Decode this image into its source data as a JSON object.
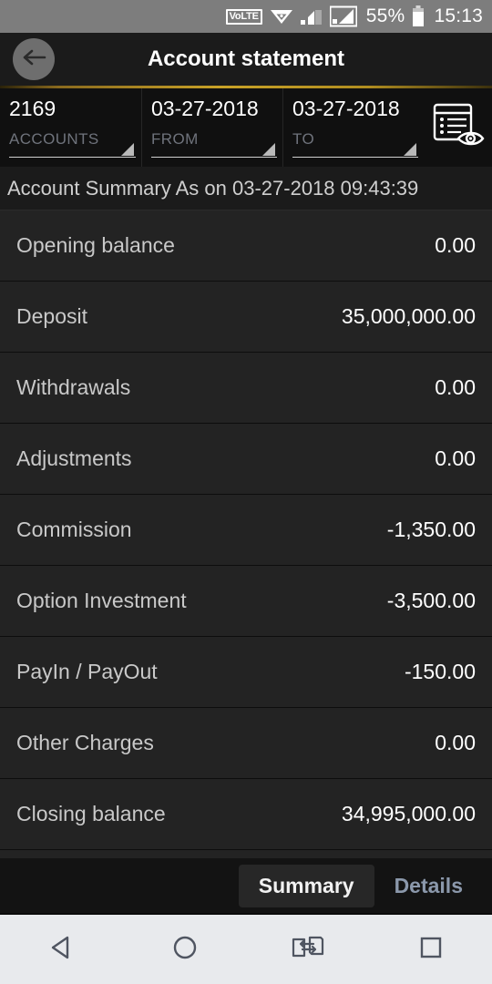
{
  "statusbar": {
    "volte": "VoLTE",
    "wifi_icon": "wifi-icon",
    "signal1_icon": "signal-bars-icon",
    "signal2_icon": "signal-bars-boxed-icon",
    "battery_percent": "55%",
    "battery_icon": "battery-icon",
    "time": "15:13",
    "background": "#7d7d7d"
  },
  "appbar": {
    "back_icon": "back-arrow-icon",
    "title": "Account statement",
    "accent_rule_color": "#c9a227",
    "background": "#1b1b1b"
  },
  "filters": [
    {
      "value": "2169",
      "label": "ACCOUNTS",
      "caret_icon": "dropdown-caret-icon"
    },
    {
      "value": "03-27-2018",
      "label": "FROM",
      "caret_icon": "dropdown-caret-icon"
    },
    {
      "value": "03-27-2018",
      "label": "TO",
      "caret_icon": "dropdown-caret-icon"
    }
  ],
  "report_icon": "document-preview-eye-icon",
  "summary_header": "Account Summary As on 03-27-2018 09:43:39",
  "statement_rows": [
    {
      "label": "Opening balance",
      "value": "0.00"
    },
    {
      "label": "Deposit",
      "value": "35,000,000.00"
    },
    {
      "label": "Withdrawals",
      "value": "0.00"
    },
    {
      "label": "Adjustments",
      "value": "0.00"
    },
    {
      "label": "Commission",
      "value": "-1,350.00"
    },
    {
      "label": "Option Investment",
      "value": "-3,500.00"
    },
    {
      "label": "PayIn / PayOut",
      "value": "-150.00"
    },
    {
      "label": "Other Charges",
      "value": "0.00"
    },
    {
      "label": "Closing balance",
      "value": "34,995,000.00"
    }
  ],
  "tabs": [
    {
      "label": "Summary",
      "active": true
    },
    {
      "label": "Details",
      "active": false
    }
  ],
  "navbar": {
    "back_icon": "nav-back-triangle-icon",
    "home_icon": "nav-home-circle-icon",
    "switch_icon": "nav-switch-apps-icon",
    "recents_icon": "nav-recents-square-icon",
    "background": "#e8eaed"
  }
}
